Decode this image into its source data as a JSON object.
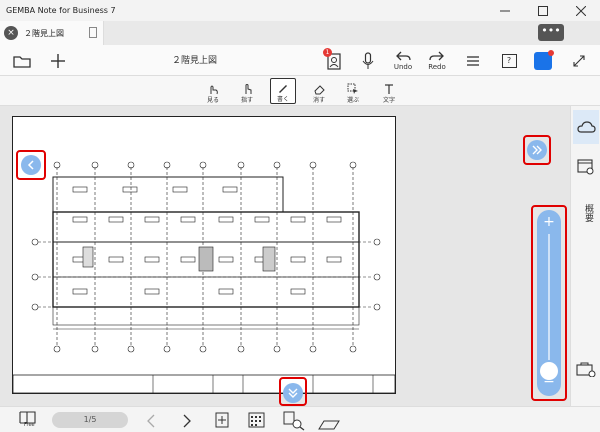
{
  "window": {
    "title": "GEMBA Note for Business 7"
  },
  "tab": {
    "name": "２階見上図"
  },
  "document": {
    "title": "２階見上図"
  },
  "toolbar": {
    "undo_label": "Undo",
    "redo_label": "Redo",
    "badge_count": "1",
    "help_label": "?"
  },
  "edit_tools": {
    "view": "見る",
    "point": "指す",
    "write": "書く",
    "erase": "消す",
    "select": "選ぶ",
    "text": "文字"
  },
  "side_panel": {
    "label": "概要"
  },
  "bottom": {
    "page_indicator": "1/5",
    "free_label": "Free"
  },
  "zoom": {
    "plus": "+",
    "minus": "−",
    "level_fraction": 0.0
  },
  "colors": {
    "accent": "#8ab8ec",
    "highlight": "#e00000",
    "app_icon": "#1a73e8"
  }
}
